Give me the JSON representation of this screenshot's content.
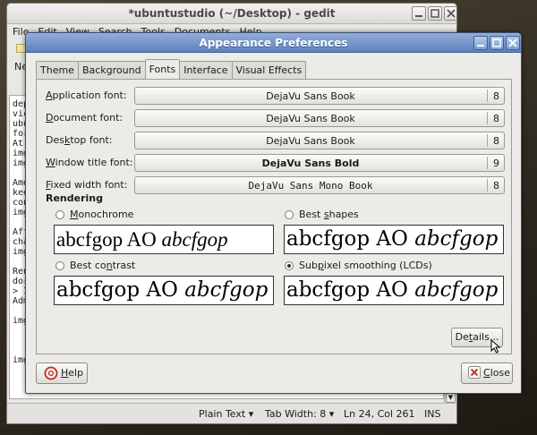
{
  "gedit": {
    "title": "*ubuntustudio (~/Desktop) - gedit",
    "menu": [
      "File",
      "Edit",
      "View",
      "Search",
      "Tools",
      "Documents",
      "Help"
    ],
    "toolbar_new": "Ne",
    "text_lines": [
      "dep",
      "vic",
      "ubu",
      "for",
      "At ",
      "img",
      "img",
      "",
      "Amo",
      "kee",
      "con",
      "img",
      "",
      "Aft",
      "cha",
      "img",
      "",
      "Ren",
      "dor",
      "> I",
      "Adm",
      "",
      "img",
      "",
      "",
      "",
      "img"
    ],
    "status": {
      "mode": "Plain Text",
      "tab_width": "Tab Width:  8",
      "position": "Ln 24, Col 261",
      "insert": "INS"
    }
  },
  "dialog": {
    "title": "Appearance Preferences",
    "tabs": [
      "Theme",
      "Background",
      "Fonts",
      "Interface",
      "Visual Effects"
    ],
    "active_tab": "Fonts",
    "fonts": [
      {
        "pre": "",
        "key": "A",
        "post": "pplication font:",
        "name": "DejaVu Sans Book",
        "size": "8"
      },
      {
        "pre": "",
        "key": "D",
        "post": "ocument font:",
        "name": "DejaVu Sans Book",
        "size": "8"
      },
      {
        "pre": "Des",
        "key": "k",
        "post": "top font:",
        "name": "DejaVu Sans Book",
        "size": "8"
      },
      {
        "pre": "",
        "key": "W",
        "post": "indow title font:",
        "name": "DejaVu Sans Bold",
        "size": "9"
      },
      {
        "pre": "",
        "key": "F",
        "post": "ixed width font:",
        "name": "DejaVu Sans Mono Book",
        "size": "8"
      }
    ],
    "rendering": {
      "heading": "Rendering",
      "options": [
        {
          "pre": "",
          "key": "M",
          "post": "onochrome",
          "selected": false
        },
        {
          "pre": "Best ",
          "key": "s",
          "post": "hapes",
          "selected": false
        },
        {
          "pre": "Best co",
          "key": "n",
          "post": "trast",
          "selected": false
        },
        {
          "pre": "Sub",
          "key": "p",
          "post": "ixel smoothing (LCDs)",
          "selected": true
        }
      ],
      "preview_plain": "abcfgop AO ",
      "preview_italic": "abcfgop"
    },
    "details_pre": "De",
    "details_key": "t",
    "details_post": "ails...",
    "help_key": "H",
    "help_post": "elp",
    "close_key": "C",
    "close_post": "lose",
    "colors": {
      "titlebar": "#6f8fc6",
      "help_icon": "#c0392b",
      "close_icon": "#c0392b"
    }
  }
}
